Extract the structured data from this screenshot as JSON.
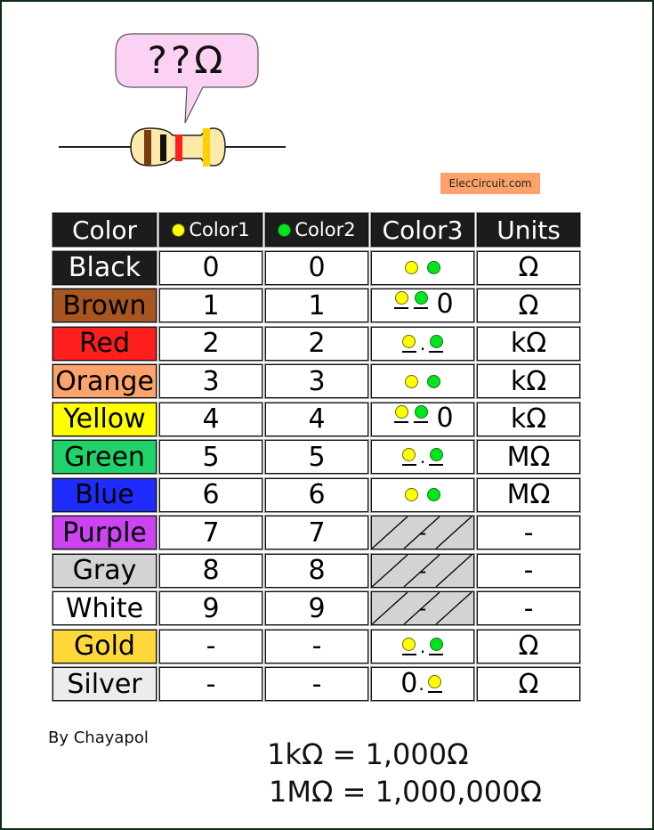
{
  "illustration": {
    "bubble_text": "??Ω",
    "resistor_bands": [
      "#7a3b12",
      "#111111",
      "#ff1e1e",
      "#ffd000"
    ],
    "resistor_body_color": "#fde9a9",
    "bubble_color": "#fcd2f4"
  },
  "brand": "ElecCircuit.com",
  "table": {
    "headers": [
      "Color",
      "Color1",
      "Color2",
      "Color3",
      "Units"
    ],
    "rows": [
      {
        "color": "Black",
        "swatch": "#1c1c1c",
        "text_color": "#ffffff",
        "c1": "0",
        "c2": "0",
        "c3_type": "two",
        "units": "Ω"
      },
      {
        "color": "Brown",
        "swatch": "#a8561f",
        "text_color": "#000000",
        "c1": "1",
        "c2": "1",
        "c3_type": "two_u_zero",
        "c3_suffix": "0",
        "units": "Ω"
      },
      {
        "color": "Red",
        "swatch": "#ff1e1e",
        "text_color": "#000000",
        "c1": "2",
        "c2": "2",
        "c3_type": "two_u_dot",
        "units": "kΩ"
      },
      {
        "color": "Orange",
        "swatch": "#fca26a",
        "text_color": "#000000",
        "c1": "3",
        "c2": "3",
        "c3_type": "two",
        "units": "kΩ"
      },
      {
        "color": "Yellow",
        "swatch": "#ffff00",
        "text_color": "#000000",
        "c1": "4",
        "c2": "4",
        "c3_type": "two_u_zero",
        "c3_suffix": "0",
        "units": "kΩ"
      },
      {
        "color": "Green",
        "swatch": "#1fd36a",
        "text_color": "#000000",
        "c1": "5",
        "c2": "5",
        "c3_type": "two_u_dot",
        "units": "MΩ"
      },
      {
        "color": "Blue",
        "swatch": "#1e2cff",
        "text_color": "#000000",
        "c1": "6",
        "c2": "6",
        "c3_type": "two",
        "units": "MΩ"
      },
      {
        "color": "Purple",
        "swatch": "#cc44f0",
        "text_color": "#000000",
        "c1": "7",
        "c2": "7",
        "c3_type": "hatched",
        "c3_text": "-",
        "units": "-"
      },
      {
        "color": "Gray",
        "swatch": "#d3d3d3",
        "text_color": "#000000",
        "c1": "8",
        "c2": "8",
        "c3_type": "hatched",
        "c3_text": "-",
        "units": "-"
      },
      {
        "color": "White",
        "swatch": "#ffffff",
        "text_color": "#000000",
        "c1": "9",
        "c2": "9",
        "c3_type": "hatched",
        "c3_text": "-",
        "units": "-"
      },
      {
        "color": "Gold",
        "swatch": "#ffd83c",
        "text_color": "#000000",
        "c1": "-",
        "c2": "-",
        "c3_type": "two_u_dot",
        "units": "Ω"
      },
      {
        "color": "Silver",
        "swatch": "#ececec",
        "text_color": "#000000",
        "c1": "-",
        "c2": "-",
        "c3_type": "zero_dot_one",
        "c3_prefix": "0",
        "units": "Ω"
      }
    ]
  },
  "author": "By Chayapol",
  "formulas": [
    "1kΩ = 1,000Ω",
    "1MΩ = 1,000,000Ω"
  ]
}
